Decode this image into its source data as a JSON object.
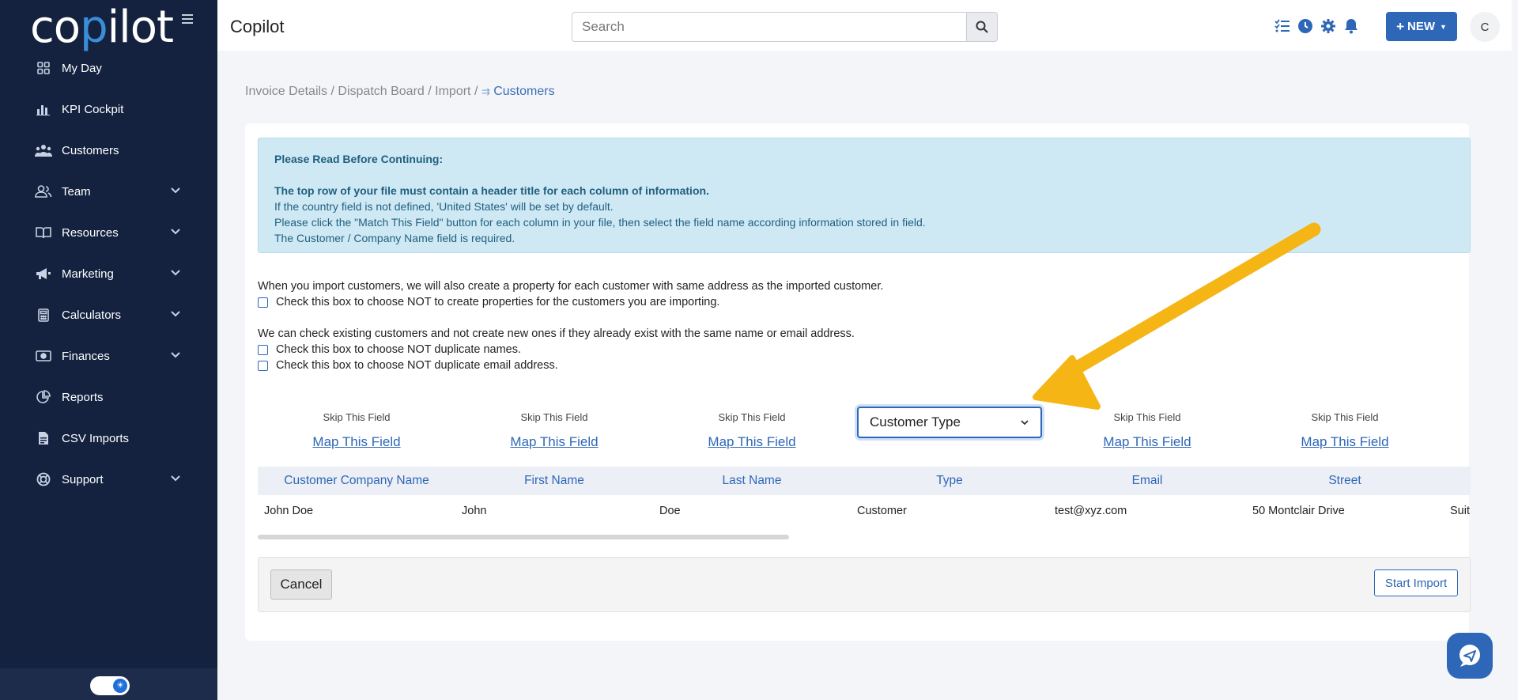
{
  "brand": {
    "logo_prefix": "co",
    "logo_accent": "p",
    "logo_suffix": "ilot"
  },
  "sidebar": {
    "items": [
      {
        "label": "My Day",
        "icon": "grid-icon",
        "has_chevron": false
      },
      {
        "label": "KPI Cockpit",
        "icon": "bar-chart-icon",
        "has_chevron": false
      },
      {
        "label": "Customers",
        "icon": "users-icon",
        "has_chevron": false
      },
      {
        "label": "Team",
        "icon": "team-icon",
        "has_chevron": true
      },
      {
        "label": "Resources",
        "icon": "book-icon",
        "has_chevron": true
      },
      {
        "label": "Marketing",
        "icon": "megaphone-icon",
        "has_chevron": true
      },
      {
        "label": "Calculators",
        "icon": "calculator-icon",
        "has_chevron": true
      },
      {
        "label": "Finances",
        "icon": "money-icon",
        "has_chevron": true
      },
      {
        "label": "Reports",
        "icon": "pie-chart-icon",
        "has_chevron": false
      },
      {
        "label": "CSV Imports",
        "icon": "file-csv-icon",
        "has_chevron": false
      },
      {
        "label": "Support",
        "icon": "lifebuoy-icon",
        "has_chevron": true
      }
    ]
  },
  "topbar": {
    "title": "Copilot",
    "search_placeholder": "Search",
    "new_label": "NEW",
    "avatar_initial": "C"
  },
  "breadcrumb": {
    "items": [
      "Invoice Details",
      "Dispatch Board",
      "Import"
    ],
    "separator": "/",
    "current": "Customers"
  },
  "alert": {
    "heading": "Please Read Before Continuing:",
    "bold_line": "The top row of your file must contain a header title for each column of information.",
    "lines": [
      "If the country field is not defined, 'United States' will be set by default.",
      "Please click the \"Match This Field\" button for each column in your file, then select the field name according information stored in field.",
      "The Customer / Company Name field is required."
    ]
  },
  "options": {
    "property_text": "When you import customers, we will also create a property for each customer with same address as the imported customer.",
    "property_checkbox": "Check this box to choose NOT to create properties for the customers you are importing.",
    "duplicate_text": "We can check existing customers and not create new ones if they already exist with the same name or email address.",
    "duplicate_names_checkbox": "Check this box to choose NOT duplicate names.",
    "duplicate_email_checkbox": "Check this box to choose NOT duplicate email address."
  },
  "mapping": {
    "skip_label": "Skip This Field",
    "map_label": "Map This Field",
    "selected_field": "Customer Type"
  },
  "table": {
    "headers": [
      "Customer Company Name",
      "First Name",
      "Last Name",
      "Type",
      "Email",
      "Street"
    ],
    "row": [
      "John Doe",
      "John",
      "Doe",
      "Customer",
      "test@xyz.com",
      "50 Montclair Drive",
      "Suit"
    ]
  },
  "actions": {
    "cancel": "Cancel",
    "start_import": "Start Import"
  },
  "colors": {
    "sidebar_bg": "#14223f",
    "accent": "#2e67b8",
    "alert_bg": "#cfe9f4",
    "arrow": "#f5b515"
  }
}
